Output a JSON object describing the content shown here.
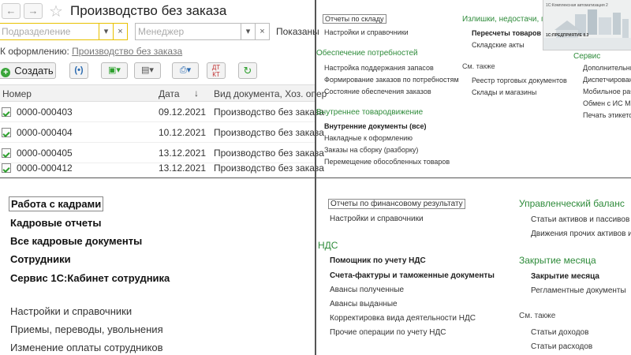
{
  "q1": {
    "title": "Производство без заказа",
    "back_icon": "←",
    "forward_icon": "→",
    "star_icon": "☆",
    "filter_department_placeholder": "Подразделение",
    "filter_manager_placeholder": "Менеджер",
    "dropdown_icon": "▾",
    "clear_icon": "×",
    "shown_label": "Показаны",
    "registration_prefix": "К оформлению:",
    "registration_link": "Производство без заказа",
    "create_button": "Создать",
    "columns": {
      "number": "Номер",
      "date": "Дата",
      "sort_icon": "↓",
      "doc_type": "Вид документа, Хоз. опер"
    },
    "rows": [
      {
        "number": "0000-000403",
        "date": "09.12.2021",
        "type": "Производство без заказа"
      },
      {
        "number": "0000-000404",
        "date": "10.12.2021",
        "type": "Производство без заказа"
      },
      {
        "number": "0000-000405",
        "date": "13.12.2021",
        "type": "Производство без заказа"
      },
      {
        "number": "0000-000412",
        "date": "13.12.2021",
        "type": "Производство без заказа"
      }
    ]
  },
  "q2": {
    "col1": {
      "reports_link": "Отчеты по складу",
      "settings_link": "Настройки и справочники",
      "supply_head": "Обеспечение потребностей",
      "supply_items": [
        "Настройка поддержания запасов",
        "Формирование заказов по потребностям",
        "Состояние обеспечения заказов"
      ],
      "internal_head": "Внутреннее товародвижение",
      "internal_items": [
        "Внутренние документы (все)",
        "Накладные к оформлению",
        "Заказы на сборку (разборку)",
        "Перемещение обособленных товаров"
      ]
    },
    "col2": {
      "surplus_head": "Излишки, недостачи, пор",
      "recount": "Пересчеты товаров",
      "warehouse_acts": "Складские акты",
      "see_also": "См. также",
      "see_items": [
        "Реестр торговых документов",
        "Склады и магазины"
      ]
    },
    "col3": {
      "service_head": "Сервис",
      "items": [
        "Дополнительны",
        "Диспетчирование",
        "Мобильное рабо",
        "Обмен с ИС МП",
        "Печать этикеток"
      ]
    },
    "splash": {
      "title": "1С:Комплексная автоматизация 2",
      "logo": "1С:ПРЕДПРИЯТИЕ 8.3"
    }
  },
  "q3": {
    "hr_work": "Работа с кадрами",
    "hr_reports": "Кадровые отчеты",
    "all_hr_docs": "Все кадровые документы",
    "employees": "Сотрудники",
    "cabinet": "Сервис 1С:Кабинет сотрудника",
    "settings": "Настройки и справочники",
    "hiring": "Приемы, переводы, увольнения",
    "salary_change": "Изменение оплаты сотрудников"
  },
  "q4": {
    "reports_link": "Отчеты по финансовому результату",
    "settings_link": "Настройки и справочники",
    "vat_head": "НДС",
    "vat_items": [
      "Помощник по учету НДС",
      "Счета-фактуры и таможенные документы",
      "Авансы полученные",
      "Авансы выданные",
      "Корректировка вида деятельности НДС",
      "Прочие операции по учету НДС"
    ],
    "mgmt_head": "Управленческий баланс",
    "mgmt_items": [
      "Статьи активов и пассивов",
      "Движения прочих активов и п"
    ],
    "close_head": "Закрытие месяца",
    "close_items": [
      "Закрытие месяца",
      "Регламентные документы"
    ],
    "see_also": "См. также",
    "see_items": [
      "Статьи доходов",
      "Статьи расходов"
    ]
  }
}
